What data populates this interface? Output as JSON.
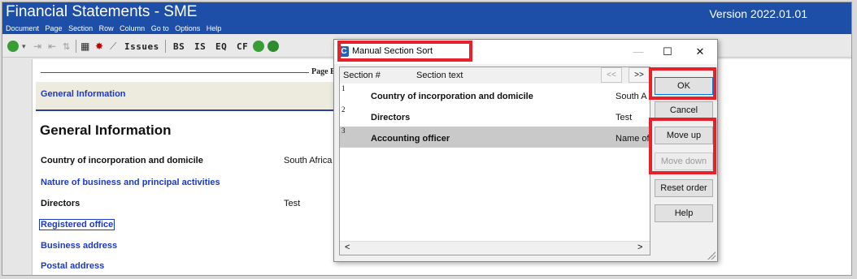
{
  "app": {
    "title": "Financial Statements - SME",
    "version": "Version 2022.01.01",
    "menu": [
      "Document",
      "Page",
      "Section",
      "Row",
      "Column",
      "Go to",
      "Options",
      "Help"
    ]
  },
  "toolbar": {
    "issues_label": "Issues",
    "statement_buttons": [
      "BS",
      "IS",
      "EQ",
      "CF"
    ]
  },
  "document": {
    "page_rule_label": "Page B",
    "section_band_label": "General Information",
    "heading": "General Information",
    "rows": [
      {
        "label": "Country of incorporation and domicile",
        "value": "South Africa",
        "style": "bold"
      },
      {
        "label": "Nature of business and principal activities",
        "value": "",
        "style": "link"
      },
      {
        "label": "Directors",
        "value": "Test",
        "style": "bold"
      },
      {
        "label": "Registered office",
        "value": "",
        "style": "link-boxed"
      },
      {
        "label": "Business address",
        "value": "",
        "style": "link"
      },
      {
        "label": "Postal address",
        "value": "",
        "style": "link"
      }
    ]
  },
  "dialog": {
    "title": "Manual Section Sort",
    "app_icon_letter": "C",
    "minimize_glyph": "—",
    "maximize_glyph": "☐",
    "close_glyph": "✕",
    "columns": {
      "section_num": "Section #",
      "section_text": "Section text"
    },
    "nav_prev": "<<",
    "nav_next": ">>",
    "rows": [
      {
        "num": "1",
        "text": "Country of incorporation and domicile",
        "value": "South A",
        "selected": false
      },
      {
        "num": "2",
        "text": "Directors",
        "value": "Test",
        "selected": false
      },
      {
        "num": "3",
        "text": "Accounting officer",
        "value": "Name of",
        "selected": true
      }
    ],
    "scroll_left": "<",
    "scroll_right": ">",
    "buttons": {
      "ok": "OK",
      "cancel": "Cancel",
      "move_up": "Move up",
      "move_down": "Move down",
      "reset_order": "Reset order",
      "help": "Help"
    }
  },
  "colors": {
    "title_bar": "#1d4fa8",
    "link_text": "#1b38c8",
    "highlight": "#e8202a",
    "selected_row": "#c9c9c9"
  }
}
